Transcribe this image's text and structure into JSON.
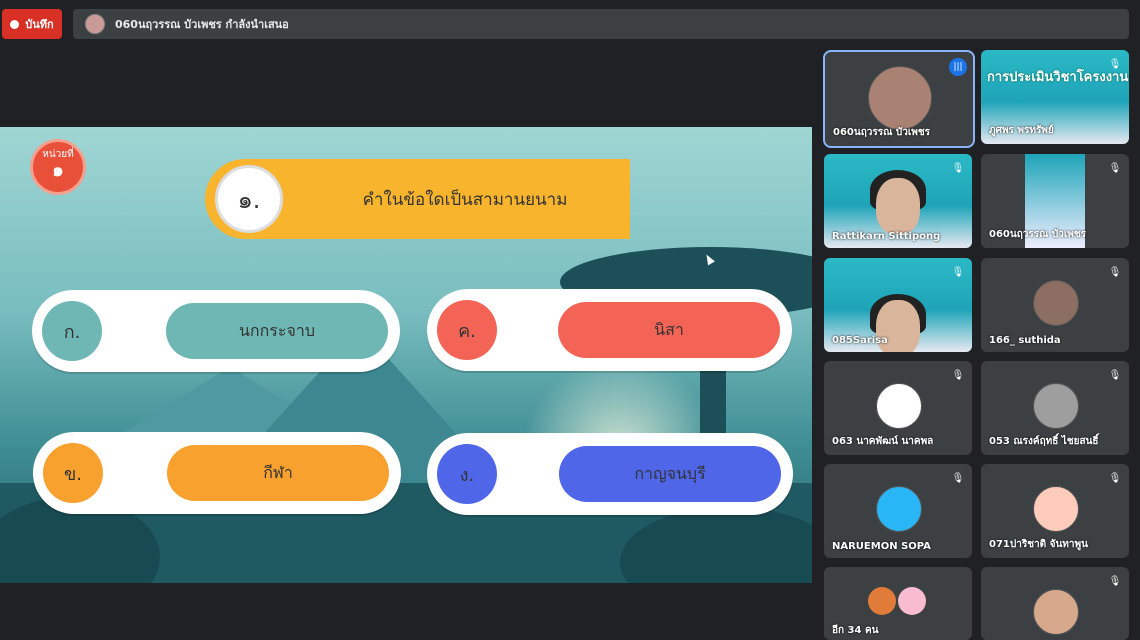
{
  "recording": {
    "label": "บันทึก"
  },
  "presenter": {
    "text": "060นฤวรรณ บัวเพชร กำลังนำเสนอ"
  },
  "slide": {
    "unit_label": "หน่วยที่",
    "unit_number": "๑",
    "question_number": "๑.",
    "question": "คำในข้อใดเป็นสามานยนาม",
    "choices": [
      {
        "letter": "ก.",
        "text": "นกกระจาบ",
        "color": "#6fb7b4"
      },
      {
        "letter": "ค.",
        "text": "นิสา",
        "color": "#f46456"
      },
      {
        "letter": "ข.",
        "text": "กีฬา",
        "color": "#f9a12f"
      },
      {
        "letter": "ง.",
        "text": "กาญจนบุรี",
        "color": "#4f66e9"
      }
    ]
  },
  "participants": [
    {
      "name": "060นฤวรรณ บัวเพชร",
      "status": "speaking"
    },
    {
      "name": "ภูศพร พรทรัพย์",
      "status": "muted"
    },
    {
      "name": "Rattikarn Sittipong",
      "status": "muted"
    },
    {
      "name": "060นฤวรรณ บัวเพชร",
      "status": "muted"
    },
    {
      "name": "085Sarisa",
      "status": "muted"
    },
    {
      "name": "166_ suthida",
      "status": "muted"
    },
    {
      "name": "063 นาคพัฒน์ นาคพล",
      "status": "muted"
    },
    {
      "name": "053 ณรงค์ฤทธิ์ ไชยสนธิ์",
      "status": "muted"
    },
    {
      "name": "NARUEMON SOPA",
      "status": "muted"
    },
    {
      "name": "071ปาริชาติ จันทาพูน",
      "status": "muted"
    },
    {
      "name": "อีก 34 คน",
      "status": "more"
    },
    {
      "name": "",
      "status": "muted"
    }
  ],
  "tile_banner_text": "การประเมินวิชาโครงงาน",
  "icons": {
    "mic_off": "🎙",
    "speaking": "|||"
  }
}
